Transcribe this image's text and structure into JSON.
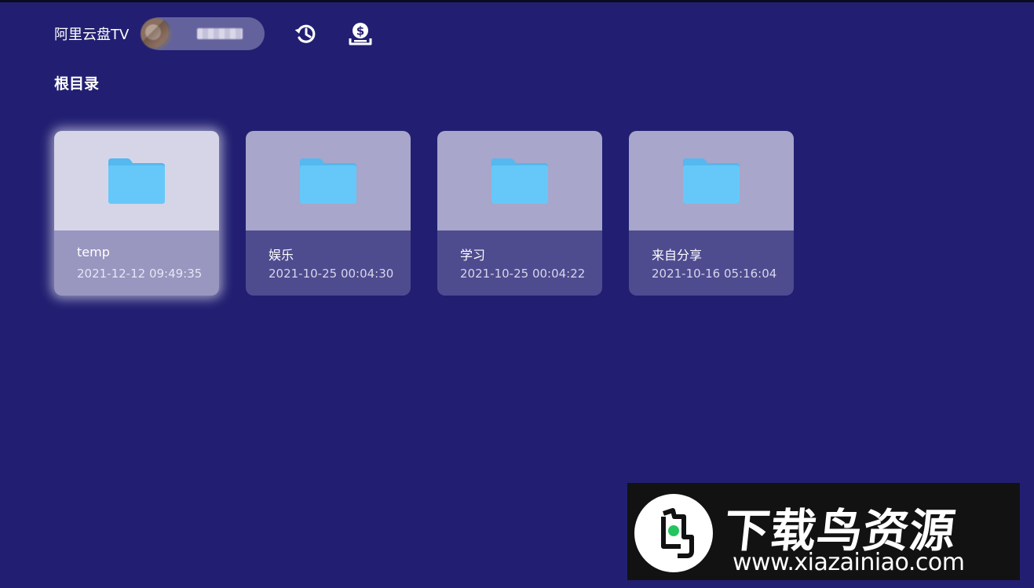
{
  "header": {
    "app_title": "阿里云盘TV",
    "account_name": "",
    "history_icon": "history-icon",
    "download_icon": "download-icon"
  },
  "breadcrumb": {
    "title": "根目录"
  },
  "folders": [
    {
      "name": "temp",
      "date": "2021-12-12 09:49:35",
      "focused": true
    },
    {
      "name": "娱乐",
      "date": "2021-10-25 00:04:30",
      "focused": false
    },
    {
      "name": "学习",
      "date": "2021-10-25 00:04:22",
      "focused": false
    },
    {
      "name": "来自分享",
      "date": "2021-10-16 05:16:04",
      "focused": false
    }
  ],
  "watermark": {
    "title": "下载鸟资源",
    "url": "www.xiazainiao.com"
  },
  "colors": {
    "background": "#221f72",
    "folder_icon": "#66c8f8",
    "card_thumb": "#a8a6ca",
    "card_info": "#4e4b8f"
  }
}
